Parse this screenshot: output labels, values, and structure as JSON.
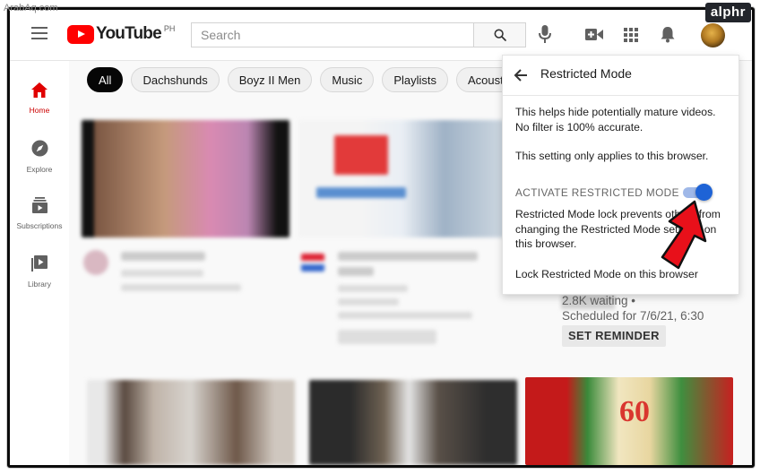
{
  "watermark": "ArabAq.com",
  "brand_badge": "alphr",
  "header": {
    "logo_text": "YouTube",
    "country": "PH",
    "search_placeholder": "Search"
  },
  "sidebar": {
    "items": [
      {
        "label": "Home",
        "icon": "home-icon",
        "active": true
      },
      {
        "label": "Explore",
        "icon": "compass-icon"
      },
      {
        "label": "Subscriptions",
        "icon": "subscriptions-icon"
      },
      {
        "label": "Library",
        "icon": "library-icon"
      }
    ]
  },
  "chips": [
    "All",
    "Dachshunds",
    "Boyz II Men",
    "Music",
    "Playlists",
    "Acoustic guitar"
  ],
  "video_meta": {
    "waiting": "2.8K waiting •",
    "scheduled": "Scheduled for 7/6/21, 6:30",
    "set_reminder": "SET REMINDER"
  },
  "restricted_panel": {
    "title": "Restricted Mode",
    "text1": "This helps hide potentially mature videos. No filter is 100% accurate.",
    "text2": "This setting only applies to this browser.",
    "activate_label": "ACTIVATE RESTRICTED MODE",
    "toggle_on": true,
    "text3": "Restricted Mode lock prevents others from changing the Restricted Mode settings on this browser.",
    "lock_link": "Lock Restricted Mode on this browser"
  },
  "colors": {
    "brand_red": "#ff0000",
    "toggle_blue": "#1e63d6",
    "annotation_arrow": "#e8101a"
  }
}
